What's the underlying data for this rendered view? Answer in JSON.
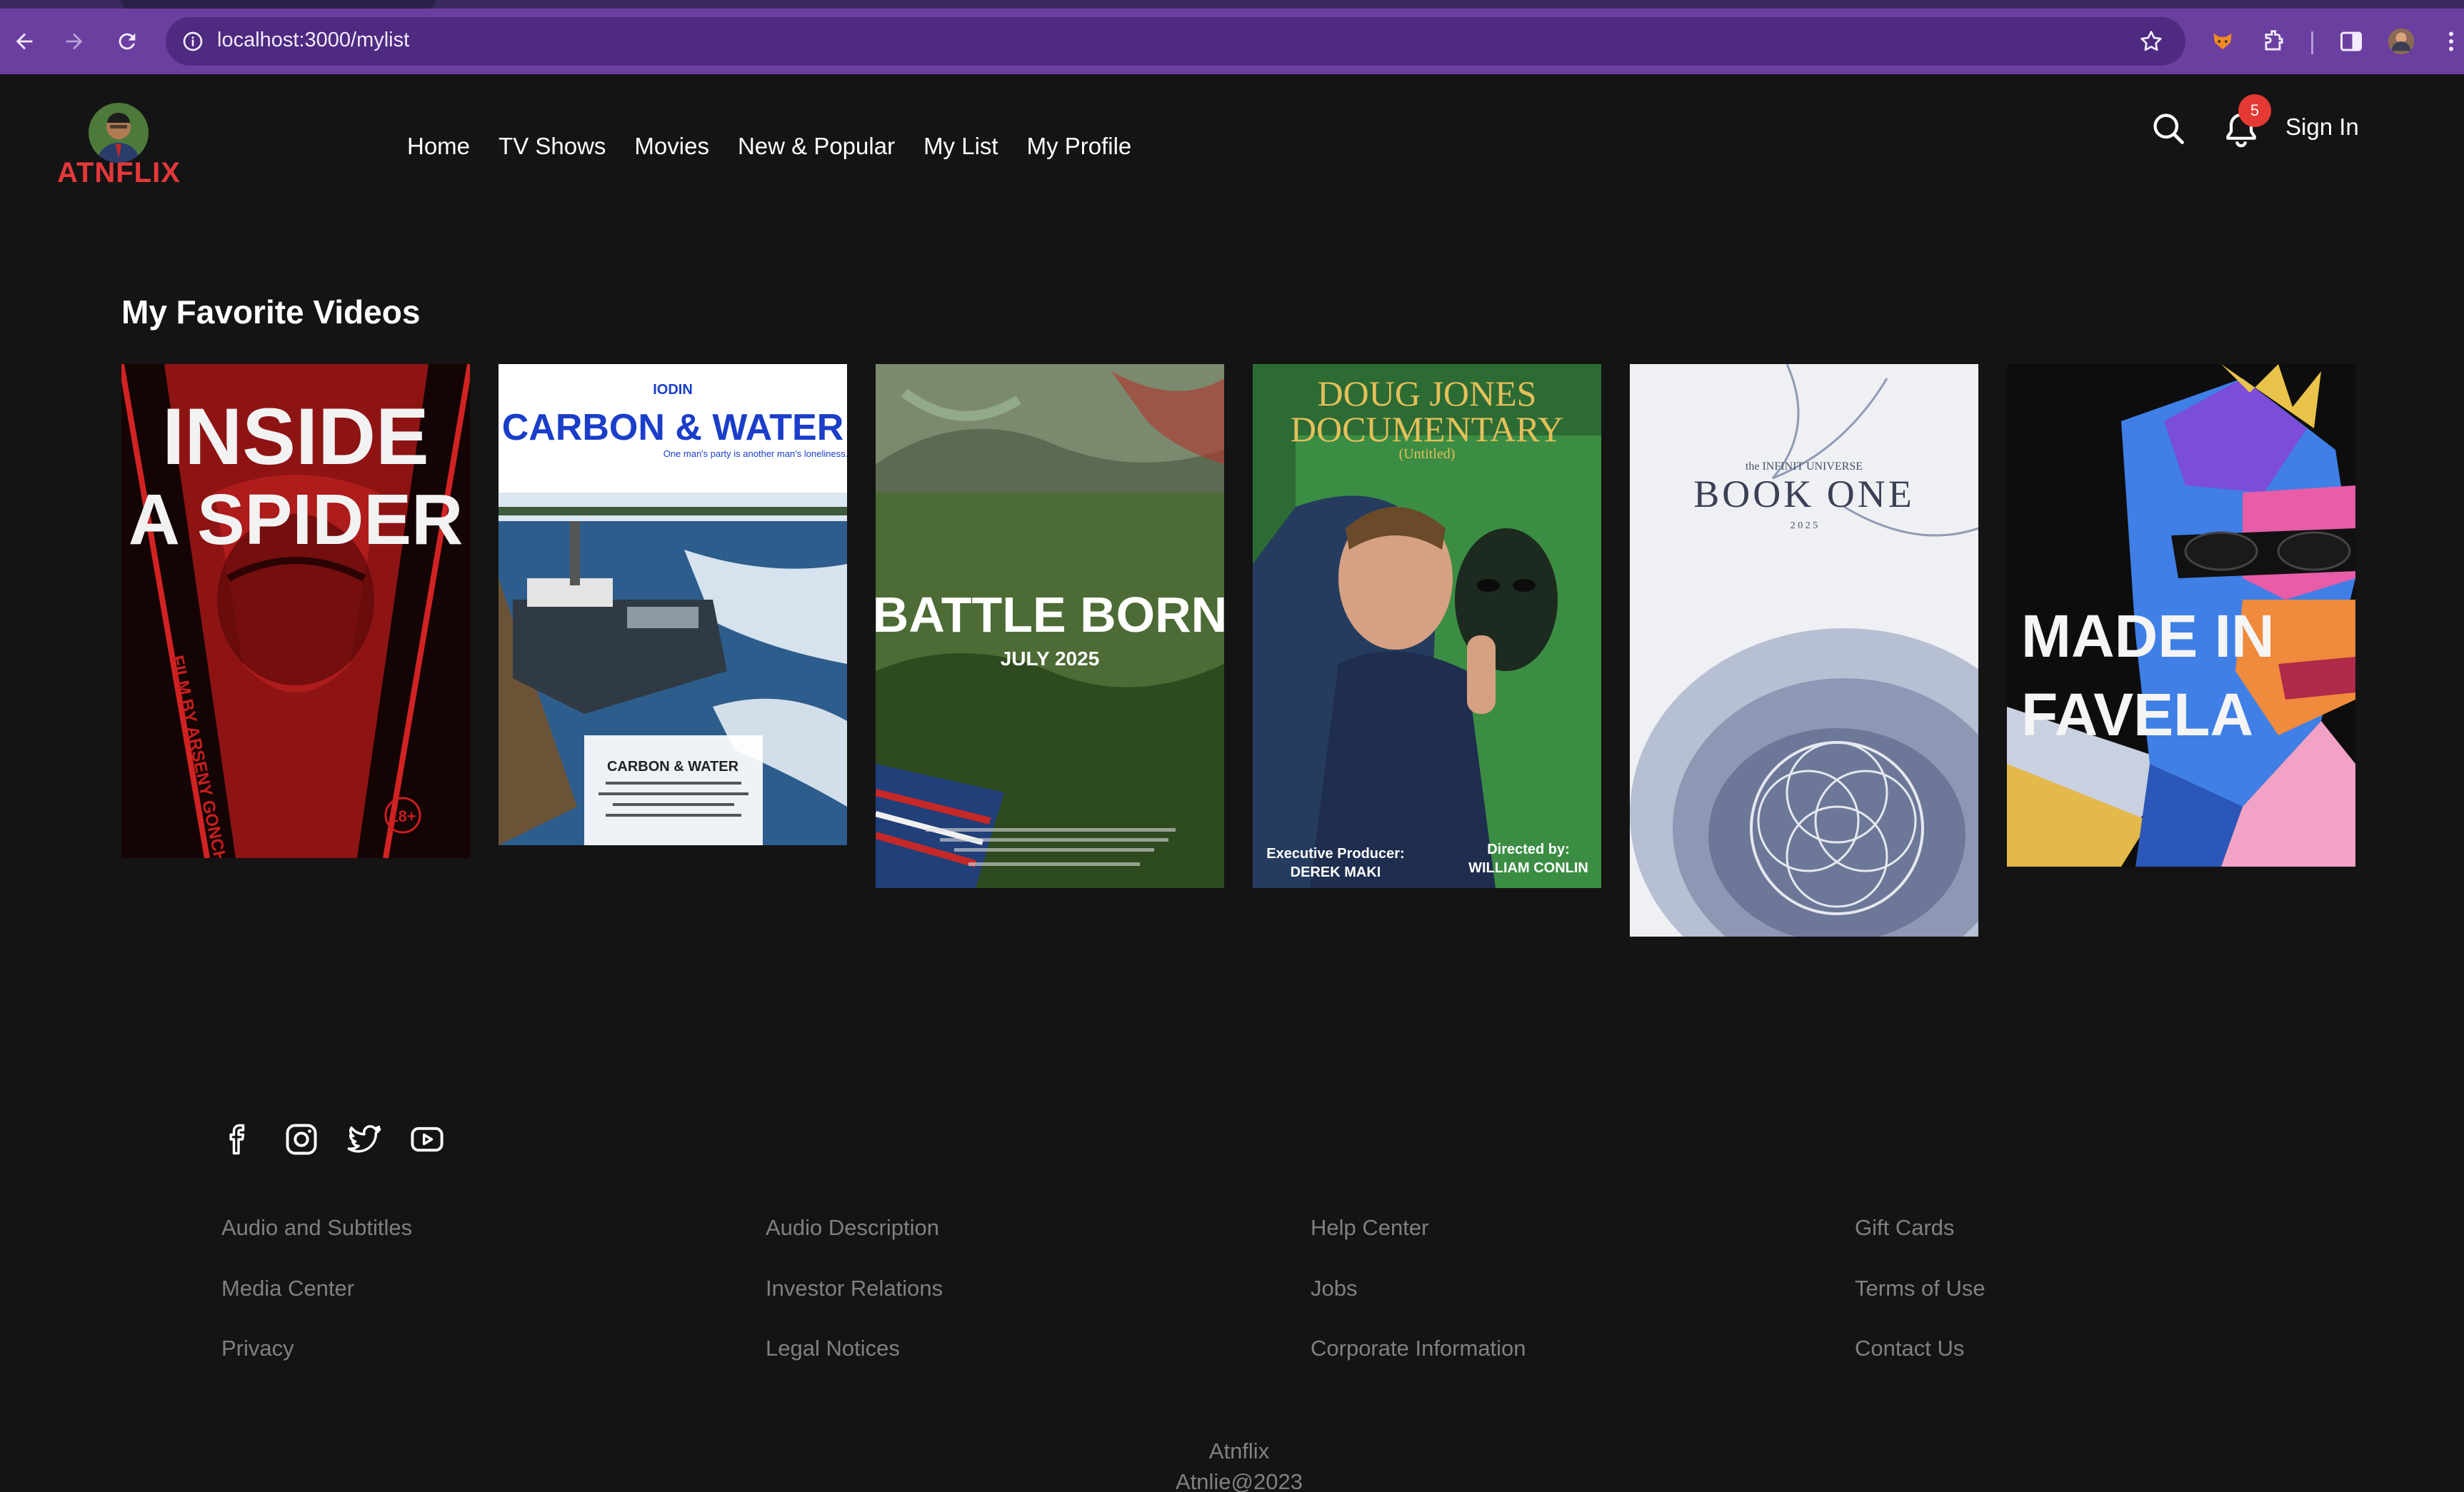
{
  "browser": {
    "url": "localhost:3000/mylist"
  },
  "header": {
    "logo": "ATNFLIX",
    "nav": [
      "Home",
      "TV Shows",
      "Movies",
      "New & Popular",
      "My List",
      "My Profile"
    ],
    "notification_count": "5",
    "sign_in": "Sign In"
  },
  "main": {
    "section_title": "My Favorite Videos",
    "posters": [
      {
        "title_lines": [
          "INSIDE",
          "A SPIDER"
        ],
        "subtitle": "FILM BY ARSENY GONCHUKOV",
        "rating": "18+"
      },
      {
        "brand": "IODIN",
        "title": "CARBON & WATER",
        "tagline": "One man's party is another man's loneliness.",
        "credit_title": "CARBON & WATER"
      },
      {
        "title": "BATTLE BORN",
        "date": "JULY 2025"
      },
      {
        "title_lines": [
          "DOUG JONES",
          "DOCUMENTARY"
        ],
        "subtitle": "(Untitled)",
        "exec_label": "Executive Producer:",
        "exec_name": "DEREK MAKI",
        "director_label": "Directed by:",
        "director_name": "WILLIAM CONLIN"
      },
      {
        "kicker": "the INFINIT UNIVERSE",
        "title": "BOOK ONE",
        "year": "2 0 2 5"
      },
      {
        "title_lines": [
          "MADE IN",
          "FAVELA"
        ]
      }
    ]
  },
  "footer": {
    "social": [
      "facebook-icon",
      "instagram-icon",
      "twitter-icon",
      "youtube-icon"
    ],
    "columns": [
      [
        "Audio and Subtitles",
        "Media Center",
        "Privacy"
      ],
      [
        "Audio Description",
        "Investor Relations",
        "Legal Notices"
      ],
      [
        "Help Center",
        "Jobs",
        "Corporate Information"
      ],
      [
        "Gift Cards",
        "Terms of Use",
        "Contact Us"
      ]
    ],
    "brand": "Atnflix",
    "copyright": "Atnlie@2023"
  },
  "colors": {
    "background": "#141414",
    "brand": "#e5383b",
    "toolbar": "#6b3fa0",
    "badge": "#e53935",
    "footer_text": "#808080"
  }
}
